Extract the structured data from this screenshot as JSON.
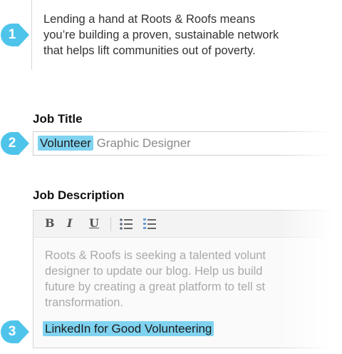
{
  "intro": {
    "lines": [
      "Lending a hand at Roots & Roofs means",
      "you’re building a proven, sustainable network",
      "that helps lift communities out of poverty."
    ]
  },
  "badges": [
    "1",
    "2",
    "3"
  ],
  "job_title": {
    "label": "Job Title",
    "highlighted": "Volunteer",
    "rest": " Graphic Designer"
  },
  "job_description": {
    "label": "Job Description",
    "toolbar": {
      "bold": "B",
      "italic": "I",
      "underline": "U"
    },
    "text_lines": [
      "Roots & Roofs is seeking a talented volunt",
      "designer to update our blog. Help us build",
      "future by creating a great platform to tell st",
      "transformation."
    ],
    "highlight_line": "LinkedIn for Good Volunteering"
  },
  "colors": {
    "highlight": "#7fd3f0",
    "badge": "#4fc4ea"
  }
}
